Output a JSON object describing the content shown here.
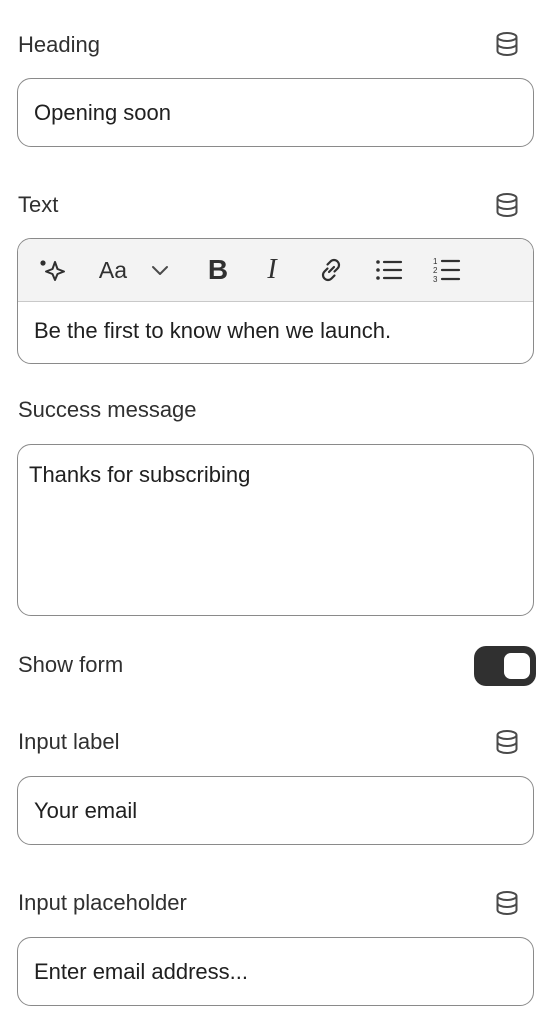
{
  "heading": {
    "label": "Heading",
    "value": "Opening soon",
    "icon": "database-icon"
  },
  "text": {
    "label": "Text",
    "icon": "database-icon",
    "toolbar": {
      "magic_icon": "sparkle-icon",
      "font_label": "Aa",
      "font_dropdown_icon": "chevron-down-icon",
      "bold_label": "B",
      "italic_label": "I",
      "link_icon": "link-icon",
      "bullet_list_icon": "bullet-list-icon",
      "numbered_list_icon": "numbered-list-icon"
    },
    "value": "Be the first to know when we launch."
  },
  "success_message": {
    "label": "Success message",
    "value": "Thanks for subscribing"
  },
  "show_form": {
    "label": "Show form",
    "enabled": true,
    "color": "#303030"
  },
  "input_label": {
    "label": "Input label",
    "value": "Your email",
    "icon": "database-icon"
  },
  "input_placeholder": {
    "label": "Input placeholder",
    "value": "Enter email address...",
    "icon": "database-icon"
  }
}
